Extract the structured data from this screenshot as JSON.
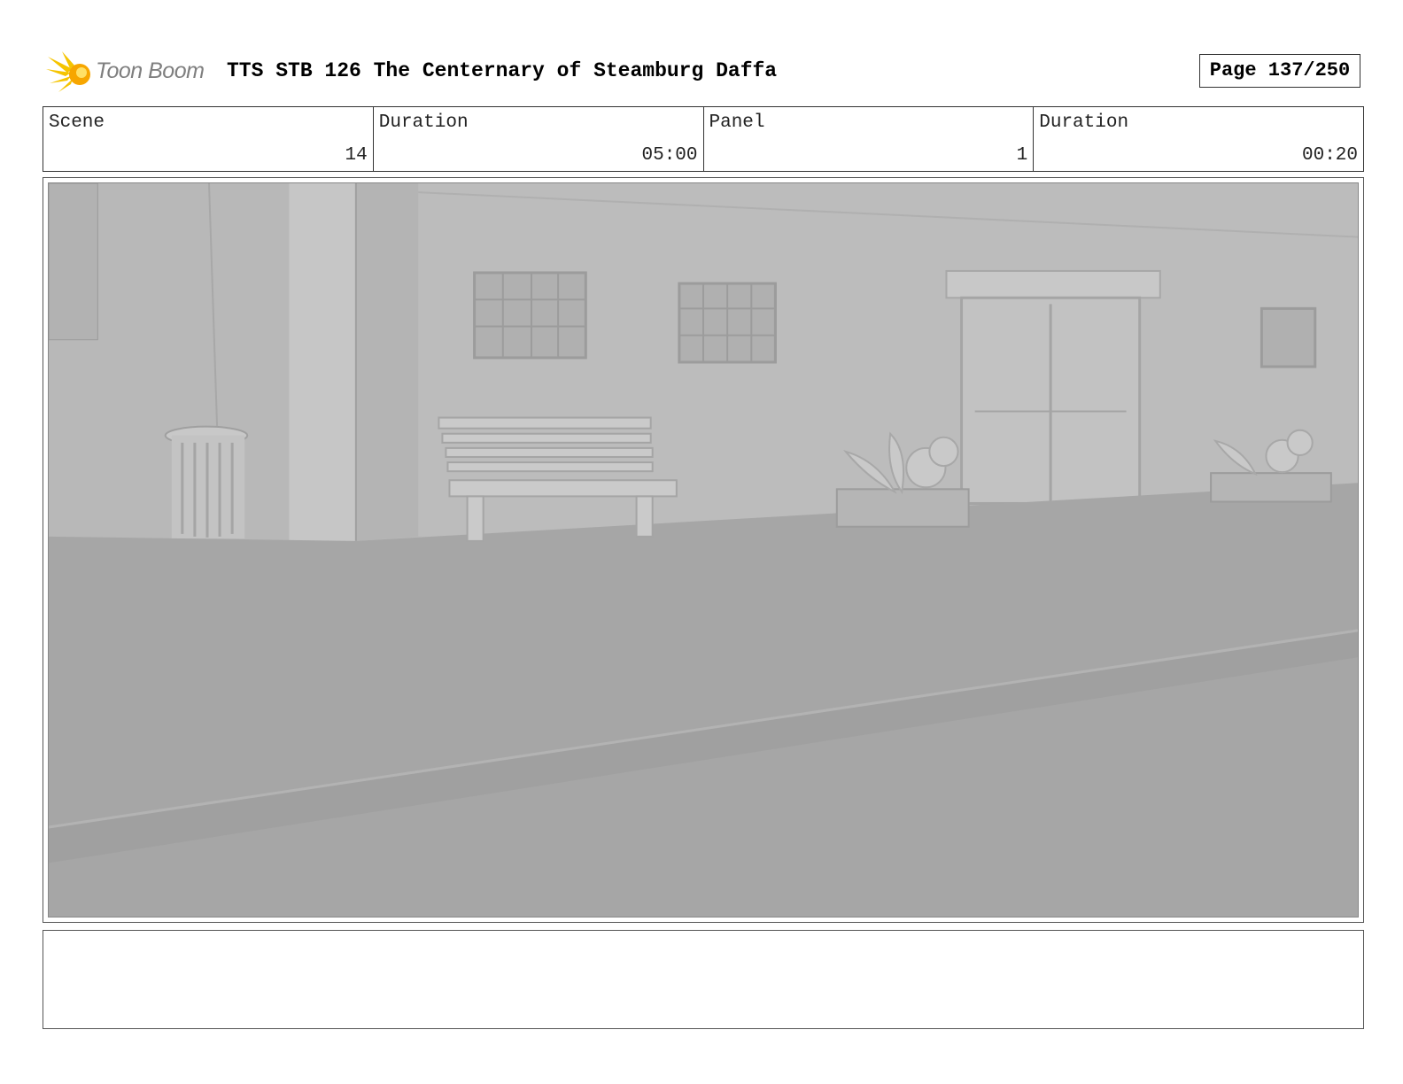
{
  "header": {
    "logo_text": "Toon Boom",
    "title": "TTS STB 126 The Centernary of Steamburg Daffa",
    "page": "Page 137/250"
  },
  "info": [
    {
      "label": "Scene",
      "value": "14"
    },
    {
      "label": "Duration",
      "value": "05:00"
    },
    {
      "label": "Panel",
      "value": "1"
    },
    {
      "label": "Duration",
      "value": "00:20"
    }
  ],
  "colors": {
    "logo_burst": "#f5c400",
    "wall": "#bcbcbc",
    "street": "#a5a5a5"
  }
}
